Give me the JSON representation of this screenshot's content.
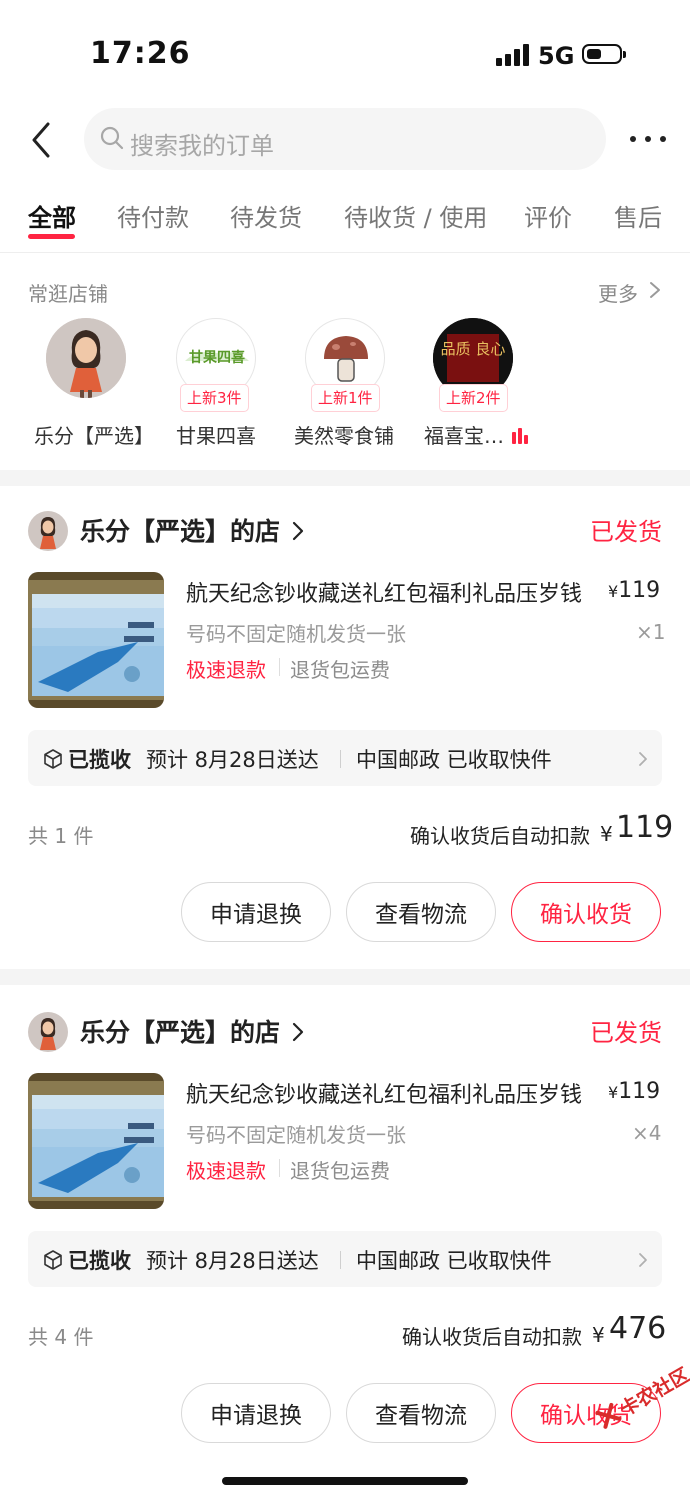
{
  "status_bar": {
    "time": "17:26",
    "network": "5G"
  },
  "header": {
    "search_placeholder": "搜索我的订单"
  },
  "tabs": [
    {
      "label": "全部",
      "active": true
    },
    {
      "label": "待付款"
    },
    {
      "label": "待发货"
    },
    {
      "label": "待收货 / 使用"
    },
    {
      "label": "评价"
    },
    {
      "label": "售后"
    }
  ],
  "favorite_shops": {
    "title": "常逛店铺",
    "more": "更多",
    "shops": [
      {
        "name": "乐分【严选】",
        "badge": ""
      },
      {
        "name": "甘果四喜",
        "badge": "上新3件",
        "logo_text": "甘果四喜"
      },
      {
        "name": "美然零食铺",
        "badge": "上新1件"
      },
      {
        "name": "福喜宝…",
        "badge": "上新2件",
        "live": true,
        "logo_text": "品质 良心"
      }
    ]
  },
  "orders": [
    {
      "store": "乐分【严选】的店",
      "status": "已发货",
      "product": {
        "title": "航天纪念钞收藏送礼红包福利礼品压岁钱",
        "price_symbol": "¥",
        "price": "119",
        "spec": "号码不固定随机发货一张",
        "quantity": "×1",
        "tags": [
          "极速退款",
          "退货包运费"
        ]
      },
      "logistics": {
        "status": "已揽收",
        "eta": "预计 8月28日送达",
        "carrier": "中国邮政 已收取快件"
      },
      "summary": {
        "count": "共 1 件",
        "label": "确认收货后自动扣款",
        "yen": "¥",
        "amount": "119"
      },
      "buttons": [
        "申请退换",
        "查看物流",
        "确认收货"
      ]
    },
    {
      "store": "乐分【严选】的店",
      "status": "已发货",
      "product": {
        "title": "航天纪念钞收藏送礼红包福利礼品压岁钱",
        "price_symbol": "¥",
        "price": "119",
        "spec": "号码不固定随机发货一张",
        "quantity": "×4",
        "tags": [
          "极速退款",
          "退货包运费"
        ]
      },
      "logistics": {
        "status": "已揽收",
        "eta": "预计 8月28日送达",
        "carrier": "中国邮政 已收取快件"
      },
      "summary": {
        "count": "共 4 件",
        "label": "确认收货后自动扣款",
        "yen": "¥",
        "amount": "476"
      },
      "buttons": [
        "申请退换",
        "查看物流",
        "确认收货"
      ]
    }
  ],
  "watermark": "卡农社区",
  "colors": {
    "accent": "#ff2442",
    "muted": "#8a8a8a",
    "divider": "#f4f4f4"
  }
}
